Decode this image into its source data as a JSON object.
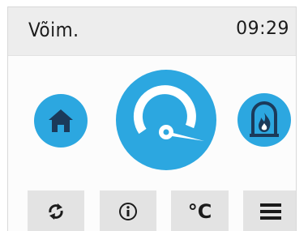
{
  "header": {
    "title": "Võim.",
    "time": "09:29"
  },
  "modes": {
    "home": {
      "icon": "home-icon"
    },
    "main": {
      "icon": "speedometer-icon"
    },
    "fireplace": {
      "icon": "fireplace-icon"
    }
  },
  "toolbar": {
    "refresh": {
      "icon": "refresh-icon"
    },
    "info": {
      "icon": "info-icon"
    },
    "unit_label": "°C",
    "menu": {
      "icon": "menu-icon"
    }
  },
  "colors": {
    "accent": "#2ca7e0",
    "header_bg": "#ededed",
    "toolbar_bg": "#e3e3e3",
    "icon_dark": "#1b3a5a"
  }
}
